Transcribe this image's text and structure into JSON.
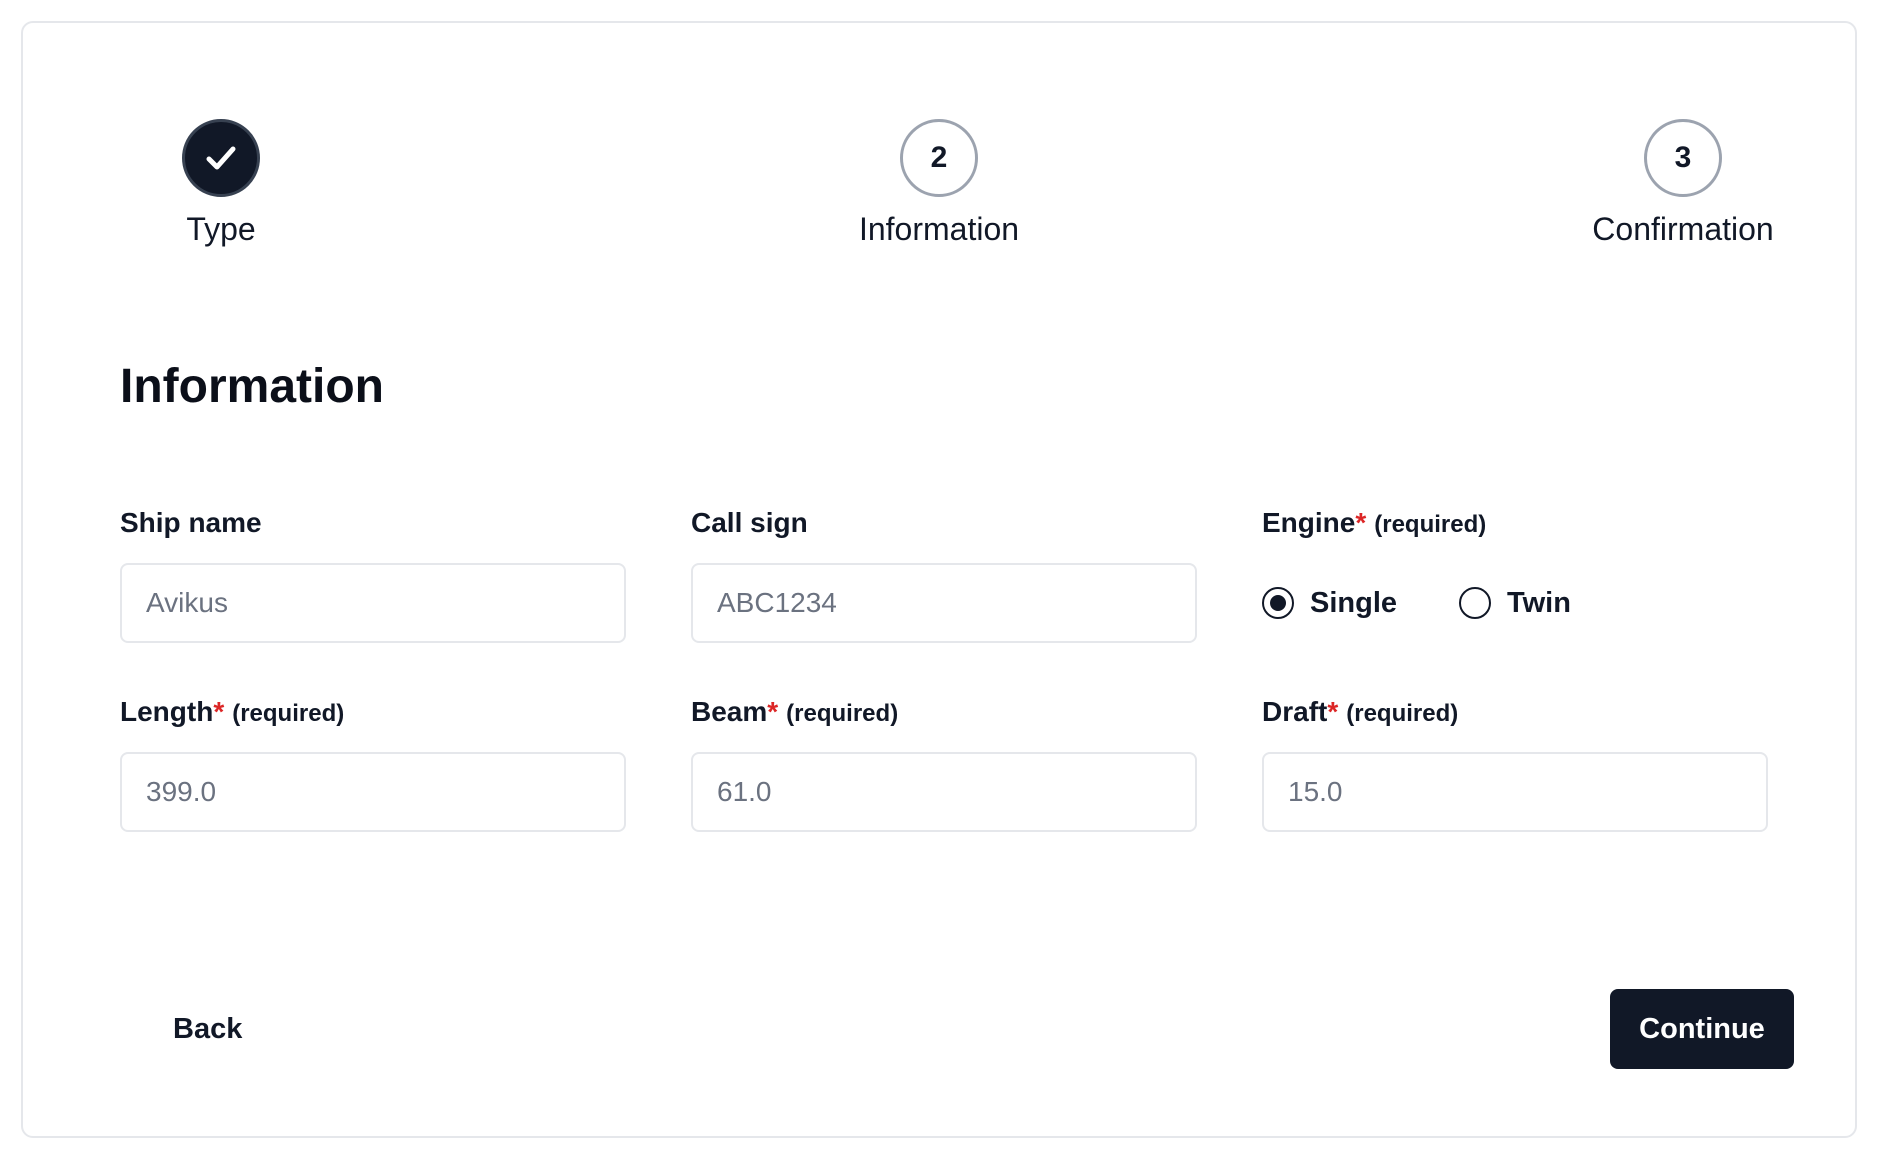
{
  "stepper": {
    "steps": [
      {
        "number": "",
        "label": "Type",
        "state": "complete",
        "icon": "check-icon"
      },
      {
        "number": "2",
        "label": "Information",
        "state": "current"
      },
      {
        "number": "3",
        "label": "Confirmation",
        "state": "upcoming"
      }
    ]
  },
  "form": {
    "title": "Information",
    "required_note": "(required)",
    "required_marker": "*",
    "ship_name": {
      "label": "Ship name",
      "value": "",
      "placeholder": "Avikus"
    },
    "call_sign": {
      "label": "Call sign",
      "value": "",
      "placeholder": "ABC1234"
    },
    "engine": {
      "label": "Engine",
      "options": [
        {
          "label": "Single",
          "checked": true
        },
        {
          "label": "Twin",
          "checked": false
        }
      ]
    },
    "length": {
      "label": "Length",
      "value": "",
      "placeholder": "399.0"
    },
    "beam": {
      "label": "Beam",
      "value": "",
      "placeholder": "61.0"
    },
    "draft": {
      "label": "Draft",
      "value": "",
      "placeholder": "15.0"
    }
  },
  "actions": {
    "back_label": "Back",
    "continue_label": "Continue"
  },
  "colors": {
    "primary": "#111827",
    "required": "#dc2626",
    "border": "#e5e7eb",
    "step_pending_border": "#9ca3af",
    "placeholder": "#6b7280"
  }
}
